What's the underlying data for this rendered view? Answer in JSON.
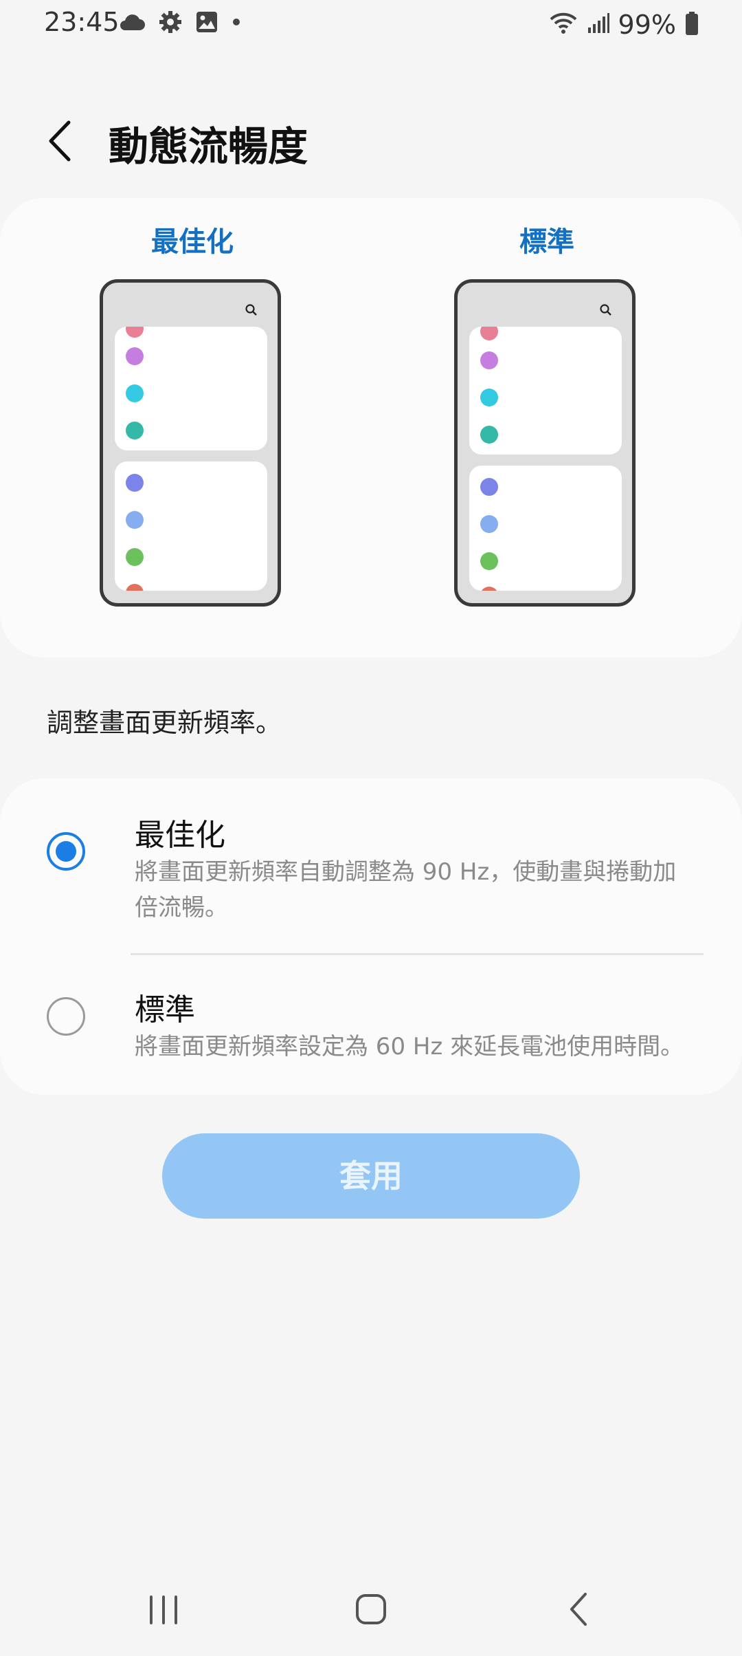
{
  "status_bar": {
    "time": "23:45",
    "battery": "99%",
    "icons_left": [
      "cloud-icon",
      "gear-icon",
      "image-icon",
      "dot-icon"
    ],
    "icons_right": [
      "wifi-icon",
      "signal-icon",
      "battery-icon"
    ]
  },
  "header": {
    "title": "動態流暢度",
    "back_icon": "chevron-left-icon"
  },
  "preview": {
    "left_label": "最佳化",
    "right_label": "標準",
    "dot_colors": [
      "#e87f95",
      "#c57de0",
      "#33c9e0",
      "#34b8a8",
      "#7c84ea",
      "#86adef",
      "#6cc15c",
      "#e36f5d"
    ]
  },
  "description": "調整畫面更新頻率。",
  "options": [
    {
      "title": "最佳化",
      "subtitle": "將畫面更新頻率自動調整為 90 Hz，使動畫與捲動加倍流暢。",
      "selected": true
    },
    {
      "title": "標準",
      "subtitle": "將畫面更新頻率設定為 60 Hz 來延長電池使用時間。",
      "selected": false
    }
  ],
  "apply_button": "套用",
  "colors": {
    "accent": "#1b7ee4",
    "label_blue": "#1470c0",
    "apply_button_bg": "#93c6f4"
  },
  "nav": {
    "recent_icon": "recent-apps-icon",
    "home_icon": "home-icon",
    "back_icon": "back-icon"
  }
}
